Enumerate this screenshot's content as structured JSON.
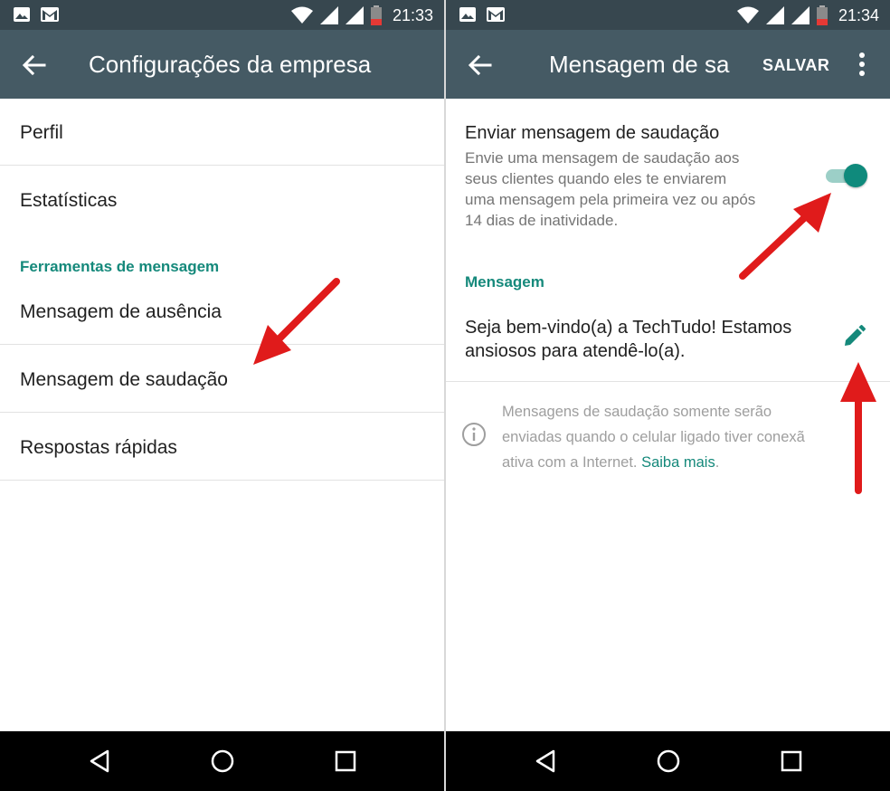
{
  "status_left": {
    "time": "21:33"
  },
  "status_right": {
    "time": "21:34"
  },
  "left": {
    "title": "Configurações da empresa",
    "items": [
      {
        "label": "Perfil"
      },
      {
        "label": "Estatísticas"
      }
    ],
    "section": "Ferramentas de mensagem",
    "tools": [
      {
        "label": "Mensagem de ausência"
      },
      {
        "label": "Mensagem de saudação"
      },
      {
        "label": "Respostas rápidas"
      }
    ]
  },
  "right": {
    "title": "Mensagem de sa",
    "save_label": "SALVAR",
    "setting_title": "Enviar mensagem de saudação",
    "setting_desc": [
      "Envie uma mensagem de saudação aos",
      "seus clientes quando eles te enviarem",
      "uma mensagem pela primeira vez ou após",
      "14 dias de inatividade."
    ],
    "toggle_on": true,
    "section": "Mensagem",
    "message": [
      "Seja bem-vindo(a) a TechTudo! Estamos",
      "ansiosos para atendê-lo(a)."
    ],
    "info": [
      "Mensagens de saudação somente serão",
      "enviadas quando o celular ligado tiver conexã",
      "ativa com a Internet. "
    ],
    "info_link": "Saiba mais",
    "info_end": "."
  },
  "icons": {
    "back": "arrow-left-icon",
    "more": "more-vert-icon",
    "edit": "pencil-icon",
    "info": "info-circle-icon",
    "nav": [
      "back-triangle-icon",
      "home-circle-icon",
      "recents-square-icon"
    ],
    "status": [
      "image-icon",
      "gmail-icon",
      "wifi-icon",
      "signal-icon",
      "battery-icon"
    ]
  },
  "colors": {
    "statusbar": "#37474f",
    "appbar": "#455a64",
    "accent": "#15897b",
    "annotation_arrow": "#e01b1b"
  }
}
